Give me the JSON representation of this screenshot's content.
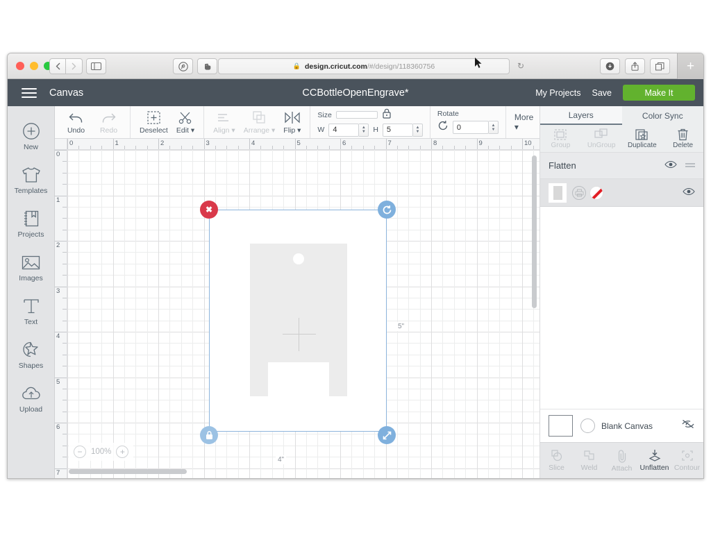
{
  "browser": {
    "url_prefix": "design.cricut.com",
    "url_suffix": "/#/design/118360756",
    "lock_icon": "lock-icon",
    "reload_icon": "reload-icon",
    "back_icon": "chevron-left-icon",
    "forward_icon": "chevron-right-icon",
    "sidebar_icon": "sidebar-toggle-icon",
    "ext1_icon": "pinterest-icon",
    "ext2_icon": "evernote-icon",
    "download_icon": "download-icon",
    "share_icon": "share-icon",
    "tabs_icon": "show-tabs-icon",
    "newtab_label": "+"
  },
  "appbar": {
    "menu_icon": "hamburger-menu-icon",
    "canvas_label": "Canvas",
    "project_title": "CCBottleOpenEngrave*",
    "my_projects": "My Projects",
    "save": "Save",
    "make_it": "Make It",
    "bg_color": "#4a535c",
    "make_it_color": "#62b22e"
  },
  "sidebar": {
    "items": [
      {
        "label": "New",
        "icon": "plus-circle-icon"
      },
      {
        "label": "Templates",
        "icon": "tshirt-icon"
      },
      {
        "label": "Projects",
        "icon": "book-icon"
      },
      {
        "label": "Images",
        "icon": "image-icon"
      },
      {
        "label": "Text",
        "icon": "text-icon"
      },
      {
        "label": "Shapes",
        "icon": "shapes-icon"
      },
      {
        "label": "Upload",
        "icon": "upload-cloud-icon"
      }
    ]
  },
  "toolbar": {
    "undo": "Undo",
    "redo": "Redo",
    "deselect": "Deselect",
    "edit": "Edit",
    "align": "Align",
    "arrange": "Arrange",
    "flip": "Flip",
    "size_label": "Size",
    "lock_icon": "lock-closed-icon",
    "w_label": "W",
    "w_value": "4",
    "h_label": "H",
    "h_value": "5",
    "rotate_label": "Rotate",
    "rotate_value": "0",
    "more": "More"
  },
  "canvas": {
    "ruler_h": [
      "0",
      "1",
      "2",
      "3",
      "4",
      "5",
      "6",
      "7",
      "8",
      "9",
      "10"
    ],
    "ruler_v": [
      "0",
      "1",
      "2",
      "3",
      "4",
      "5",
      "6",
      "7"
    ],
    "width_dim": "4\"",
    "height_dim": "5\"",
    "zoom_value": "100%",
    "zoom_out_icon": "minus-circle-icon",
    "zoom_in_icon": "plus-circle-icon",
    "handles": {
      "delete": "delete-handle-icon",
      "rotate": "rotate-handle-icon",
      "lock": "lock-handle-icon",
      "resize": "resize-handle-icon"
    }
  },
  "panel": {
    "tabs": [
      {
        "label": "Layers",
        "active": true
      },
      {
        "label": "Color Sync",
        "active": false
      }
    ],
    "actions": [
      {
        "label": "Group",
        "icon": "group-icon",
        "enabled": false
      },
      {
        "label": "UnGroup",
        "icon": "ungroup-icon",
        "enabled": false
      },
      {
        "label": "Duplicate",
        "icon": "duplicate-icon",
        "enabled": true
      },
      {
        "label": "Delete",
        "icon": "trash-icon",
        "enabled": true
      }
    ],
    "layer_group": {
      "title": "Flatten",
      "visibility_icon": "eye-icon",
      "menu_icon": "layer-menu-icon"
    },
    "layer_row": {
      "thumb_icon": "layer-thumbnail",
      "print_icon": "print-icon",
      "color_icon": "no-color-swatch-icon",
      "swatch_color": "#e21f26",
      "visibility_icon": "eye-icon"
    },
    "blank_canvas": {
      "label": "Blank Canvas",
      "swatch_icon": "canvas-color-swatch",
      "circle_icon": "canvas-pattern-circle",
      "visibility_icon": "eye-off-icon"
    },
    "bottom_actions": [
      {
        "label": "Slice",
        "icon": "slice-icon",
        "enabled": false
      },
      {
        "label": "Weld",
        "icon": "weld-icon",
        "enabled": false
      },
      {
        "label": "Attach",
        "icon": "attach-paperclip-icon",
        "enabled": false
      },
      {
        "label": "Unflatten",
        "icon": "unflatten-icon",
        "enabled": true
      },
      {
        "label": "Contour",
        "icon": "contour-icon",
        "enabled": false
      }
    ]
  }
}
